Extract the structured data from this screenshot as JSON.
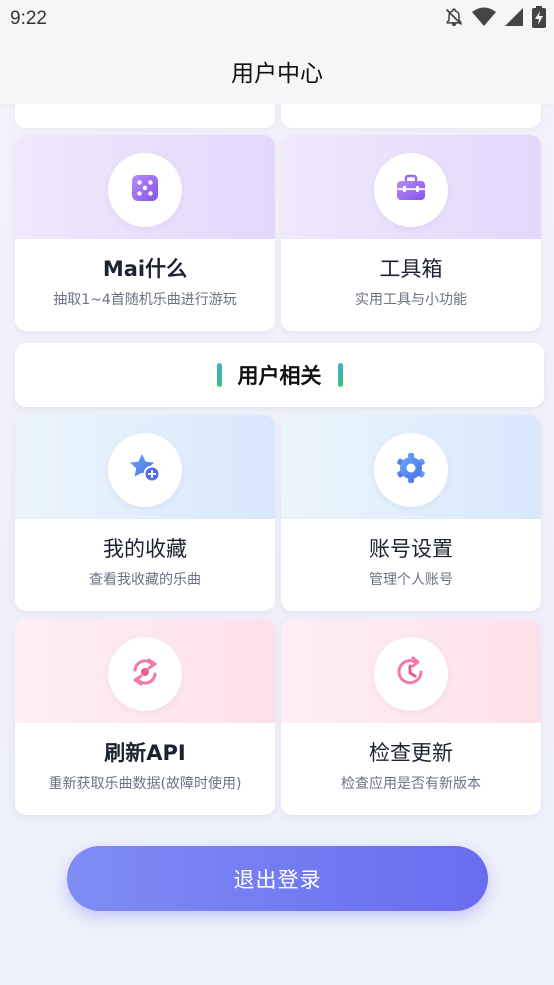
{
  "status_bar": {
    "time": "9:22",
    "icons": [
      "notifications-off-icon",
      "wifi-icon",
      "signal-icon",
      "battery-charging-icon"
    ]
  },
  "app_bar": {
    "title": "用户中心"
  },
  "cards_top": [
    {
      "name": "Mai什么",
      "desc": "抽取1~4首随机乐曲进行游玩",
      "icon": "dice-icon",
      "accent": "#9b6cf0"
    },
    {
      "name": "工具箱",
      "desc": "实用工具与小功能",
      "icon": "toolbox-icon",
      "accent": "#9b6cf0"
    }
  ],
  "section": {
    "title": "用户相关"
  },
  "cards_user": [
    {
      "name": "我的收藏",
      "desc": "查看我收藏的乐曲",
      "icon": "star-add-icon",
      "accent": "#5b7ff0"
    },
    {
      "name": "账号设置",
      "desc": "管理个人账号",
      "icon": "gear-icon",
      "accent": "#5b7ff0"
    },
    {
      "name": "刷新API",
      "desc": "重新获取乐曲数据(故障时使用)",
      "icon": "refresh-icon",
      "accent": "#f07aa8"
    },
    {
      "name": "检查更新",
      "desc": "检查应用是否有新版本",
      "icon": "clock-update-icon",
      "accent": "#f07aa8"
    }
  ],
  "logout_button": {
    "label": "退出登录"
  }
}
